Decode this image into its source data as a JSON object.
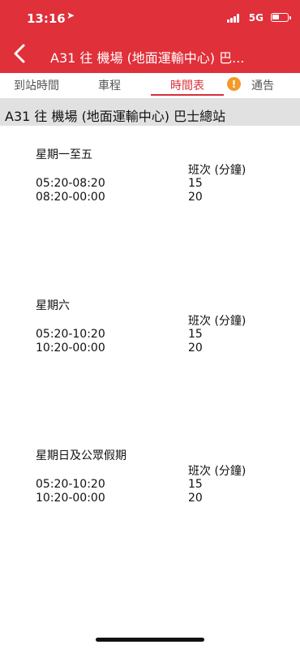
{
  "status_bar": {
    "time": "13:16",
    "network": "5G"
  },
  "nav": {
    "title": "A31 往 機場 (地面運輸中心) 巴..."
  },
  "tabs": [
    {
      "label": "到站時間"
    },
    {
      "label": "車程"
    },
    {
      "label": "時間表"
    },
    {
      "label": "通告"
    }
  ],
  "section": {
    "title": "A31 往 機場 (地面運輸中心) 巴士總站"
  },
  "timetable": {
    "column_header": "班次 (分鐘)",
    "groups": [
      {
        "day": "星期一至五",
        "rows": [
          {
            "period": "05:20-08:20",
            "freq": "15"
          },
          {
            "period": "08:20-00:00",
            "freq": "20"
          }
        ]
      },
      {
        "day": "星期六",
        "rows": [
          {
            "period": "05:20-10:20",
            "freq": "15"
          },
          {
            "period": "10:20-00:00",
            "freq": "20"
          }
        ]
      },
      {
        "day": "星期日及公眾假期",
        "rows": [
          {
            "period": "05:20-10:20",
            "freq": "15"
          },
          {
            "period": "10:20-00:00",
            "freq": "20"
          }
        ]
      }
    ]
  },
  "colors": {
    "brand": "#e0303a",
    "active_tab": "#d8303a",
    "alert": "#f39a2a",
    "section_bg": "#e1e1e1"
  },
  "icons": {
    "back": "chevron-left-icon",
    "alert": "exclamation-circle-icon",
    "location": "location-arrow-icon"
  }
}
